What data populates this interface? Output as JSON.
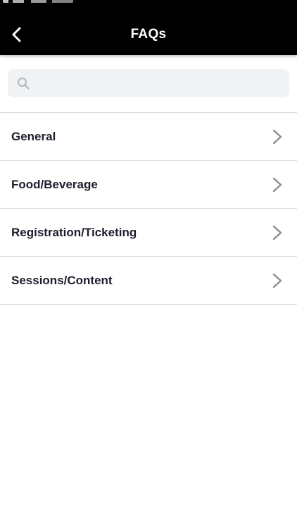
{
  "header": {
    "title": "FAQs",
    "back_icon": "chevron-left-icon"
  },
  "search": {
    "placeholder": "",
    "value": "",
    "icon": "search-icon"
  },
  "faq_categories": [
    {
      "label": "General",
      "icon": "chevron-right-icon"
    },
    {
      "label": "Food/Beverage",
      "icon": "chevron-right-icon"
    },
    {
      "label": "Registration/Ticketing",
      "icon": "chevron-right-icon"
    },
    {
      "label": "Sessions/Content",
      "icon": "chevron-right-icon"
    }
  ],
  "colors": {
    "header_background": "#000000",
    "header_text": "#ffffff",
    "search_background": "#f1f2f4",
    "item_text": "#1b1f2a",
    "divider": "#dcdcdc",
    "chevron": "#8a8d93"
  }
}
